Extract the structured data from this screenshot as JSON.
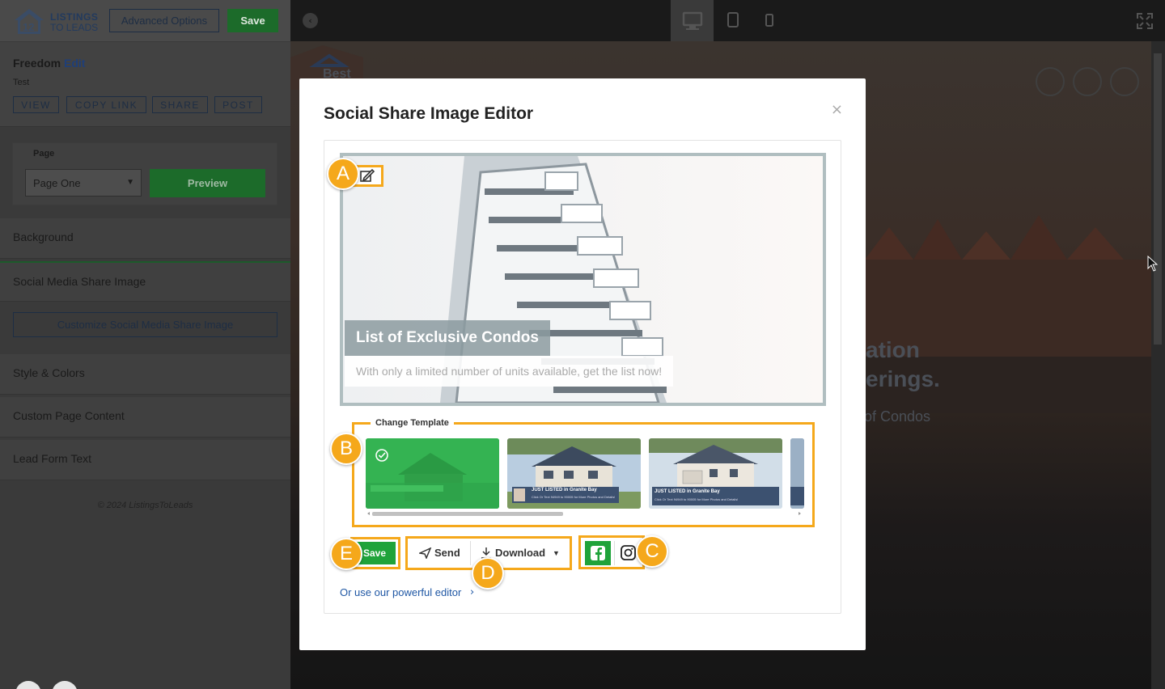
{
  "app": {
    "logo_line1": "LISTINGS",
    "logo_line2": "TO LEADS",
    "advanced_label": "Advanced Options",
    "save_label": "Save"
  },
  "page_info": {
    "name": "Freedom",
    "edit_label": "Edit",
    "subtitle": "Test",
    "actions": [
      "VIEW",
      "COPY LINK",
      "SHARE",
      "POST"
    ]
  },
  "page_selector": {
    "label": "Page",
    "selected": "Page One",
    "preview_label": "Preview"
  },
  "sections": {
    "background": "Background",
    "social_media": "Social Media Share Image",
    "customize_btn": "Customize Social Media Share Image",
    "style_colors": "Style & Colors",
    "custom_content": "Custom Page Content",
    "lead_form": "Lead Form Text"
  },
  "copyright": "© 2024 ListingsToLeads",
  "preview": {
    "headline_fragment_1": "ation",
    "headline_fragment_2": "erings.",
    "sub_fragment": "of Condos",
    "logo_fragment": "Best"
  },
  "modal": {
    "title": "Social Share Image Editor",
    "close": "×",
    "caption_title": "List of Exclusive Condos",
    "caption_sub": "With only a limited number of units available, get the list now!",
    "change_template_label": "Change Template",
    "templates": [
      {
        "banner": ""
      },
      {
        "banner": "JUST LISTED in Granite Bay",
        "banner_sub": "Click Or Text 94949 to 90005 for More Photos and Details!"
      },
      {
        "banner": "JUST LISTED in Granite Bay",
        "banner_sub": "Click Or Text 94949 to 90005 for More Photos and Details!"
      }
    ],
    "save_label": "Save",
    "send_label": "Send",
    "download_label": "Download",
    "powerful_editor": "Or use our powerful editor"
  },
  "markers": [
    "A",
    "B",
    "C",
    "D",
    "E"
  ],
  "colors": {
    "accent_orange": "#f5a81b",
    "primary_green": "#1fa33a",
    "link_blue": "#1f57a4"
  }
}
